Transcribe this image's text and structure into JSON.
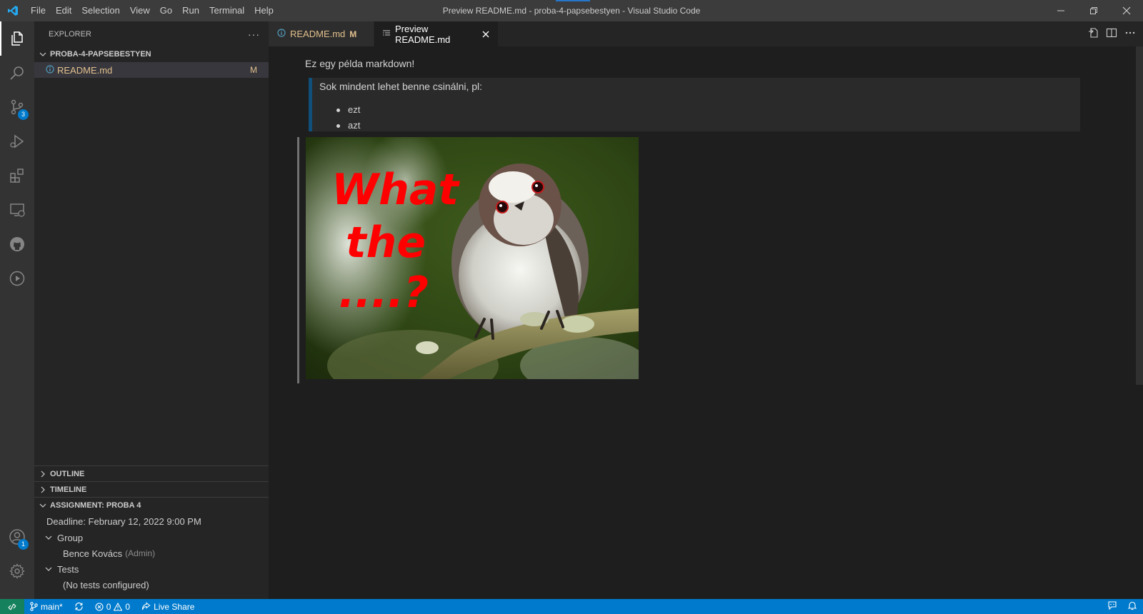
{
  "window": {
    "title": "Preview README.md - proba-4-papsebestyen - Visual Studio Code",
    "menu": [
      "File",
      "Edit",
      "Selection",
      "View",
      "Go",
      "Run",
      "Terminal",
      "Help"
    ]
  },
  "activity": {
    "source_control_badge": "3",
    "accounts_badge": "1"
  },
  "sidebar": {
    "header": "EXPLORER",
    "more": "···",
    "folder": "PROBA-4-PAPSEBESTYEN",
    "file": {
      "name": "README.md",
      "status": "M"
    },
    "outline": "OUTLINE",
    "timeline": "TIMELINE",
    "assignment": {
      "title": "ASSIGNMENT: PROBA 4",
      "deadline": "Deadline: February 12, 2022 9:00 PM",
      "group_label": "Group",
      "member_name": "Bence Kovács",
      "member_role": "(Admin)",
      "tests_label": "Tests",
      "tests_value": "(No tests configured)"
    }
  },
  "editor": {
    "tabs": [
      {
        "label": "README.md",
        "status": "M"
      },
      {
        "label": "Preview README.md"
      }
    ],
    "preview": {
      "paragraph": "Ez egy példa markdown!",
      "quote": "Sok mindent lehet benne csinálni, pl:",
      "list": [
        "ezt",
        "azt"
      ],
      "image_text": {
        "line1": "What",
        "line2": "the",
        "line3": "....?"
      }
    }
  },
  "statusbar": {
    "branch": "main*",
    "errors": "0",
    "warnings": "0",
    "live_share": "Live Share"
  },
  "colors": {
    "accent": "#007acc",
    "modified": "#e2c08d",
    "remote": "#16825d",
    "meme_text": "#ff0000"
  }
}
